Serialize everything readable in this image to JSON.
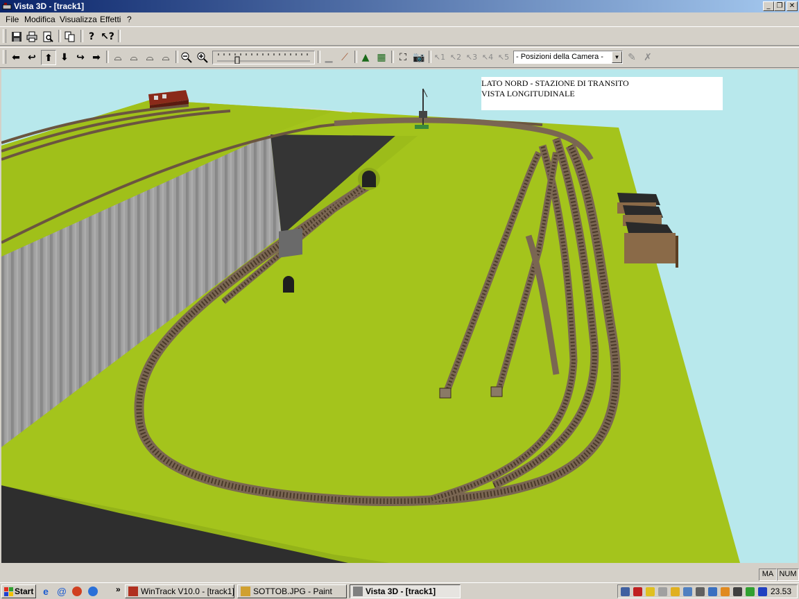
{
  "window": {
    "title": "Vista 3D - [track1]",
    "min": "_",
    "max": "❐",
    "close": "✕"
  },
  "menu": [
    "File",
    "Modifica",
    "Visualizza",
    "Effetti",
    "?"
  ],
  "toolbar1": {
    "buttons": [
      {
        "name": "save-button",
        "icon": "💾"
      },
      {
        "name": "print-button",
        "icon": "🖶"
      },
      {
        "name": "print-preview-button",
        "icon": "🔍"
      },
      {
        "name": "copy-button",
        "icon": "⎘"
      },
      {
        "name": "help-button",
        "icon": "?"
      },
      {
        "name": "context-help-button",
        "icon": "?"
      }
    ]
  },
  "toolbar2": {
    "camera_combo": "- Posizioni della Camera -"
  },
  "scene": {
    "caption_line1": "LATO NORD - STAZIONE DI TRANSITO",
    "caption_line2": "VISTA LONGITUDINALE",
    "sky_color": "#b8e8ec",
    "grass_color": "#a4c41c",
    "track_color": "#6b5540"
  },
  "status": {
    "caps": "MA",
    "num": "NUM"
  },
  "taskbar": {
    "start": "Start",
    "tasks": [
      {
        "label": "WinTrack  V10.0 - [track1]",
        "active": false
      },
      {
        "label": "SOTTOB.JPG - Paint",
        "active": false
      },
      {
        "label": "Vista 3D - [track1]",
        "active": true
      }
    ],
    "more": "»",
    "clock": "23.53"
  }
}
